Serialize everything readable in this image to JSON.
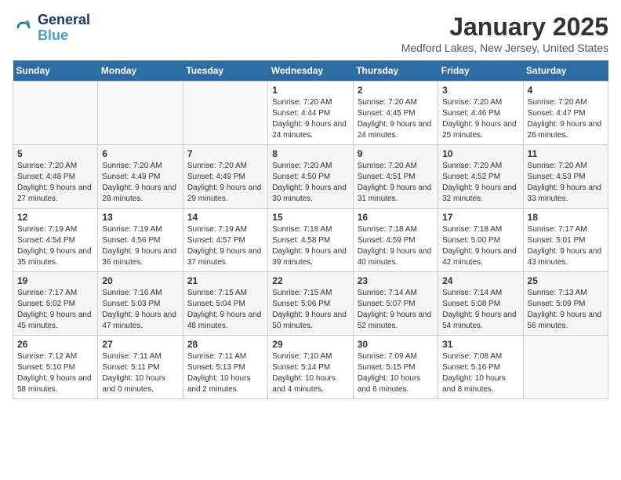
{
  "header": {
    "logo_line1": "General",
    "logo_line2": "Blue",
    "title": "January 2025",
    "subtitle": "Medford Lakes, New Jersey, United States"
  },
  "days_of_week": [
    "Sunday",
    "Monday",
    "Tuesday",
    "Wednesday",
    "Thursday",
    "Friday",
    "Saturday"
  ],
  "weeks": [
    [
      {
        "day": "",
        "sunrise": "",
        "sunset": "",
        "daylight": ""
      },
      {
        "day": "",
        "sunrise": "",
        "sunset": "",
        "daylight": ""
      },
      {
        "day": "",
        "sunrise": "",
        "sunset": "",
        "daylight": ""
      },
      {
        "day": "1",
        "sunrise": "Sunrise: 7:20 AM",
        "sunset": "Sunset: 4:44 PM",
        "daylight": "Daylight: 9 hours and 24 minutes."
      },
      {
        "day": "2",
        "sunrise": "Sunrise: 7:20 AM",
        "sunset": "Sunset: 4:45 PM",
        "daylight": "Daylight: 9 hours and 24 minutes."
      },
      {
        "day": "3",
        "sunrise": "Sunrise: 7:20 AM",
        "sunset": "Sunset: 4:46 PM",
        "daylight": "Daylight: 9 hours and 25 minutes."
      },
      {
        "day": "4",
        "sunrise": "Sunrise: 7:20 AM",
        "sunset": "Sunset: 4:47 PM",
        "daylight": "Daylight: 9 hours and 26 minutes."
      }
    ],
    [
      {
        "day": "5",
        "sunrise": "Sunrise: 7:20 AM",
        "sunset": "Sunset: 4:48 PM",
        "daylight": "Daylight: 9 hours and 27 minutes."
      },
      {
        "day": "6",
        "sunrise": "Sunrise: 7:20 AM",
        "sunset": "Sunset: 4:49 PM",
        "daylight": "Daylight: 9 hours and 28 minutes."
      },
      {
        "day": "7",
        "sunrise": "Sunrise: 7:20 AM",
        "sunset": "Sunset: 4:49 PM",
        "daylight": "Daylight: 9 hours and 29 minutes."
      },
      {
        "day": "8",
        "sunrise": "Sunrise: 7:20 AM",
        "sunset": "Sunset: 4:50 PM",
        "daylight": "Daylight: 9 hours and 30 minutes."
      },
      {
        "day": "9",
        "sunrise": "Sunrise: 7:20 AM",
        "sunset": "Sunset: 4:51 PM",
        "daylight": "Daylight: 9 hours and 31 minutes."
      },
      {
        "day": "10",
        "sunrise": "Sunrise: 7:20 AM",
        "sunset": "Sunset: 4:52 PM",
        "daylight": "Daylight: 9 hours and 32 minutes."
      },
      {
        "day": "11",
        "sunrise": "Sunrise: 7:20 AM",
        "sunset": "Sunset: 4:53 PM",
        "daylight": "Daylight: 9 hours and 33 minutes."
      }
    ],
    [
      {
        "day": "12",
        "sunrise": "Sunrise: 7:19 AM",
        "sunset": "Sunset: 4:54 PM",
        "daylight": "Daylight: 9 hours and 35 minutes."
      },
      {
        "day": "13",
        "sunrise": "Sunrise: 7:19 AM",
        "sunset": "Sunset: 4:56 PM",
        "daylight": "Daylight: 9 hours and 36 minutes."
      },
      {
        "day": "14",
        "sunrise": "Sunrise: 7:19 AM",
        "sunset": "Sunset: 4:57 PM",
        "daylight": "Daylight: 9 hours and 37 minutes."
      },
      {
        "day": "15",
        "sunrise": "Sunrise: 7:18 AM",
        "sunset": "Sunset: 4:58 PM",
        "daylight": "Daylight: 9 hours and 39 minutes."
      },
      {
        "day": "16",
        "sunrise": "Sunrise: 7:18 AM",
        "sunset": "Sunset: 4:59 PM",
        "daylight": "Daylight: 9 hours and 40 minutes."
      },
      {
        "day": "17",
        "sunrise": "Sunrise: 7:18 AM",
        "sunset": "Sunset: 5:00 PM",
        "daylight": "Daylight: 9 hours and 42 minutes."
      },
      {
        "day": "18",
        "sunrise": "Sunrise: 7:17 AM",
        "sunset": "Sunset: 5:01 PM",
        "daylight": "Daylight: 9 hours and 43 minutes."
      }
    ],
    [
      {
        "day": "19",
        "sunrise": "Sunrise: 7:17 AM",
        "sunset": "Sunset: 5:02 PM",
        "daylight": "Daylight: 9 hours and 45 minutes."
      },
      {
        "day": "20",
        "sunrise": "Sunrise: 7:16 AM",
        "sunset": "Sunset: 5:03 PM",
        "daylight": "Daylight: 9 hours and 47 minutes."
      },
      {
        "day": "21",
        "sunrise": "Sunrise: 7:15 AM",
        "sunset": "Sunset: 5:04 PM",
        "daylight": "Daylight: 9 hours and 48 minutes."
      },
      {
        "day": "22",
        "sunrise": "Sunrise: 7:15 AM",
        "sunset": "Sunset: 5:06 PM",
        "daylight": "Daylight: 9 hours and 50 minutes."
      },
      {
        "day": "23",
        "sunrise": "Sunrise: 7:14 AM",
        "sunset": "Sunset: 5:07 PM",
        "daylight": "Daylight: 9 hours and 52 minutes."
      },
      {
        "day": "24",
        "sunrise": "Sunrise: 7:14 AM",
        "sunset": "Sunset: 5:08 PM",
        "daylight": "Daylight: 9 hours and 54 minutes."
      },
      {
        "day": "25",
        "sunrise": "Sunrise: 7:13 AM",
        "sunset": "Sunset: 5:09 PM",
        "daylight": "Daylight: 9 hours and 56 minutes."
      }
    ],
    [
      {
        "day": "26",
        "sunrise": "Sunrise: 7:12 AM",
        "sunset": "Sunset: 5:10 PM",
        "daylight": "Daylight: 9 hours and 58 minutes."
      },
      {
        "day": "27",
        "sunrise": "Sunrise: 7:11 AM",
        "sunset": "Sunset: 5:11 PM",
        "daylight": "Daylight: 10 hours and 0 minutes."
      },
      {
        "day": "28",
        "sunrise": "Sunrise: 7:11 AM",
        "sunset": "Sunset: 5:13 PM",
        "daylight": "Daylight: 10 hours and 2 minutes."
      },
      {
        "day": "29",
        "sunrise": "Sunrise: 7:10 AM",
        "sunset": "Sunset: 5:14 PM",
        "daylight": "Daylight: 10 hours and 4 minutes."
      },
      {
        "day": "30",
        "sunrise": "Sunrise: 7:09 AM",
        "sunset": "Sunset: 5:15 PM",
        "daylight": "Daylight: 10 hours and 6 minutes."
      },
      {
        "day": "31",
        "sunrise": "Sunrise: 7:08 AM",
        "sunset": "Sunset: 5:16 PM",
        "daylight": "Daylight: 10 hours and 8 minutes."
      },
      {
        "day": "",
        "sunrise": "",
        "sunset": "",
        "daylight": ""
      }
    ]
  ]
}
